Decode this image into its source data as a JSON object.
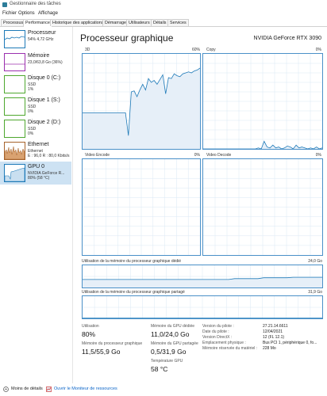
{
  "window": {
    "title": "Gestionnaire des tâches"
  },
  "menu": [
    "Fichier",
    "Options",
    "Affichage"
  ],
  "tabs": [
    "Processus",
    "Performance",
    "Historique des applications",
    "Démarrage",
    "Utilisateurs",
    "Détails",
    "Services"
  ],
  "active_tab": "Performance",
  "sidebar": [
    {
      "title": "Processeur",
      "line1": "54%  4,72 GHz",
      "line2": "",
      "color": "#1e7ab8"
    },
    {
      "title": "Mémoire",
      "line1": "23,0/63,8 Go (36%)",
      "line2": "",
      "color": "#9b2fae"
    },
    {
      "title": "Disque 0 (C:)",
      "line1": "SSD",
      "line2": "1%",
      "color": "#4ea72e"
    },
    {
      "title": "Disque 1 (S:)",
      "line1": "SSD",
      "line2": "0%",
      "color": "#4ea72e"
    },
    {
      "title": "Disque 2 (D:)",
      "line1": "SSD",
      "line2": "0%",
      "color": "#4ea72e"
    },
    {
      "title": "Ethernet",
      "line1": "Ethernet",
      "line2": "E : 96,0  R : 80,0 Kbits/s",
      "color": "#a6622b"
    },
    {
      "title": "GPU 0",
      "line1": "NVIDIA GeForce R...",
      "line2": "80% (58 °C)",
      "color": "#1e7ab8"
    }
  ],
  "selected_index": 6,
  "header": {
    "title": "Processeur graphique",
    "gpu_name": "NVIDIA GeForce RTX 3090"
  },
  "graphs": {
    "g3d": {
      "label": "3D",
      "pct": "60%"
    },
    "copy": {
      "label": "Copy",
      "pct": "0%"
    },
    "encode": {
      "label": "Video Encode",
      "pct": "0%"
    },
    "decode": {
      "label": "Video Decode",
      "pct": "0%"
    },
    "dedicated": {
      "label": "Utilisation de la mémoire du processeur graphique dédié",
      "max": "24,0 Go"
    },
    "shared": {
      "label": "Utilisation de la mémoire du processeur graphique partagé",
      "max": "31,9 Go"
    }
  },
  "stats": {
    "utilisation": {
      "label": "Utilisation",
      "value": "80%"
    },
    "gpu_mem": {
      "label": "Mémoire du processeur graphique",
      "value": "11,5/55,9 Go"
    },
    "dedicated_mem": {
      "label": "Mémoire du GPU dédiée",
      "value": "11,0/24,0 Go"
    },
    "shared_mem": {
      "label": "Mémoire du GPU partagée",
      "value": "0,5/31,9 Go"
    },
    "temperature": {
      "label": "Température GPU",
      "value": "58 °C"
    }
  },
  "info": [
    {
      "key": "Version du pilote :",
      "value": "27.21.14.6611"
    },
    {
      "key": "Date du pilote :",
      "value": "12/04/2021"
    },
    {
      "key": "Version DirectX :",
      "value": "12 (FL 12.1)"
    },
    {
      "key": "Emplacement physique :",
      "value": "Bus PCI 1, périphérique 0, fo..."
    },
    {
      "key": "Mémoire réservée du matériel :",
      "value": "228 Mo"
    }
  ],
  "footer": {
    "less_details": "Moins de détails",
    "open_monitor": "Ouvrir le Moniteur de ressources"
  },
  "chart_data": [
    {
      "type": "area",
      "series": [
        {
          "values": [
            38,
            38,
            38,
            38,
            38,
            38,
            38,
            38,
            38,
            38,
            38,
            38,
            38,
            38,
            38,
            38,
            14,
            60,
            61,
            55,
            62,
            68,
            62,
            74,
            70,
            72,
            68,
            73,
            78,
            58,
            75,
            74,
            79,
            77,
            76,
            79,
            80,
            81,
            80,
            82,
            83,
            85
          ]
        }
      ],
      "ylim": [
        0,
        100
      ]
    },
    {
      "type": "area",
      "series": [
        {
          "values": [
            0,
            0,
            0,
            0,
            0,
            0,
            0,
            0,
            0,
            0,
            0,
            0,
            0,
            0,
            0,
            0,
            0,
            0,
            0,
            1,
            0,
            8,
            2,
            1,
            4,
            1,
            2,
            0,
            1,
            3,
            2,
            0,
            4,
            1,
            2,
            1,
            0,
            1,
            0,
            2,
            0,
            1
          ]
        }
      ],
      "ylim": [
        0,
        100
      ]
    },
    {
      "type": "area",
      "series": [
        {
          "values": [
            36,
            36,
            36,
            36,
            36,
            36,
            36,
            36,
            36,
            36,
            36,
            36,
            36,
            36,
            36,
            36,
            36,
            36,
            36,
            36,
            36,
            36,
            36,
            36,
            36,
            36,
            40,
            40,
            40,
            40,
            40,
            44,
            44,
            44,
            44,
            44,
            46,
            46,
            46,
            46,
            46,
            46
          ]
        }
      ],
      "ylim": [
        0,
        100
      ]
    },
    {
      "type": "area",
      "series": [
        {
          "values": [
            1,
            1,
            1,
            1,
            1,
            1,
            1,
            1,
            1,
            1,
            1,
            1,
            1,
            1,
            1,
            1,
            1,
            1,
            1,
            1,
            1,
            1,
            1,
            1,
            1,
            1,
            1,
            1,
            1,
            1,
            1,
            1,
            1,
            1,
            1,
            1,
            1,
            1,
            1,
            1,
            1,
            1
          ]
        }
      ],
      "ylim": [
        0,
        100
      ]
    }
  ]
}
